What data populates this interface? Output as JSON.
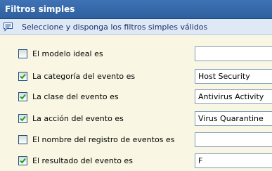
{
  "panel": {
    "title": "Filtros simples",
    "info_icon": "comment-icon",
    "info_text": "Seleccione y disponga los filtros simples válidos"
  },
  "filters": [
    {
      "label": "El modelo ideal es",
      "checked": false,
      "value": ""
    },
    {
      "label": "La categoría del evento es",
      "checked": true,
      "value": "Host Security"
    },
    {
      "label": "La clase del evento es",
      "checked": true,
      "value": "Antivirus Activity"
    },
    {
      "label": "La acción del evento es",
      "checked": true,
      "value": "Virus Quarantine"
    },
    {
      "label": "El nombre del registro de eventos es",
      "checked": false,
      "value": ""
    },
    {
      "label": "El resultado del evento es",
      "checked": true,
      "value": "F"
    }
  ],
  "colors": {
    "title_bar": "#3a6eb0",
    "info_bar": "#dfe9f6",
    "panel_bg": "#f9f7e3",
    "checkbox_border": "#1c5180",
    "checkmark": "#21a121",
    "field_border": "#7f9db9"
  }
}
